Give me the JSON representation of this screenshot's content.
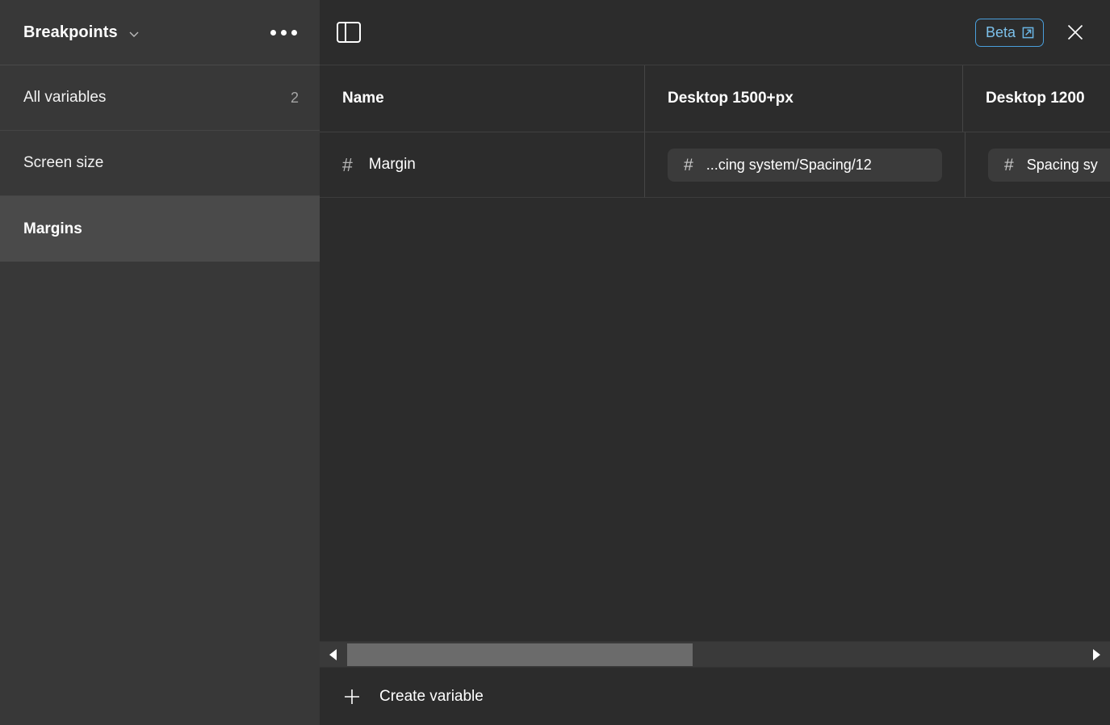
{
  "sidebar": {
    "title": "Breakpoints",
    "chevron_icon": "chevron-down-icon",
    "more_icon": "more-options-icon",
    "items": [
      {
        "label": "All variables",
        "count": "2",
        "selected": false
      },
      {
        "label": "Screen size",
        "count": "",
        "selected": false
      },
      {
        "label": "Margins",
        "count": "",
        "selected": true
      }
    ]
  },
  "header": {
    "panel_toggle_icon": "sidebar-toggle-icon",
    "beta_label": "Beta",
    "beta_external_icon": "external-link-icon",
    "close_icon": "close-icon",
    "beta_accent_color": "#4a9fdc"
  },
  "table": {
    "columns": [
      {
        "label": "Name"
      },
      {
        "label": "Desktop 1500+px"
      },
      {
        "label": "Desktop 1200"
      }
    ],
    "rows": [
      {
        "type_icon": "hash-icon",
        "name": "Margin",
        "values": [
          {
            "type_icon": "hash-icon",
            "text": "...cing system/Spacing/12"
          },
          {
            "type_icon": "hash-icon",
            "text": "Spacing sy"
          }
        ]
      }
    ]
  },
  "scrollbar": {
    "left_arrow_icon": "scroll-left-arrow-icon",
    "right_arrow_icon": "scroll-right-arrow-icon"
  },
  "footer": {
    "plus_icon": "plus-icon",
    "create_label": "Create variable"
  }
}
